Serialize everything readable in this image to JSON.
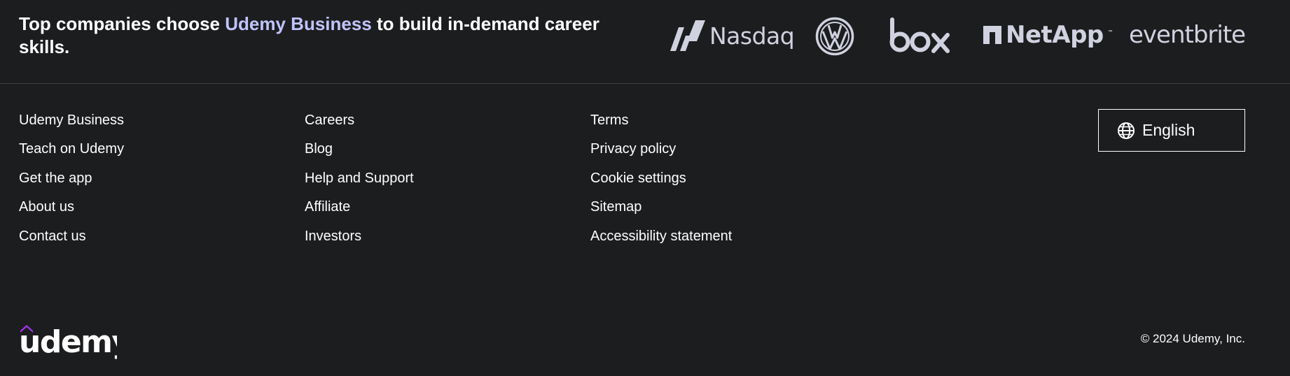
{
  "header": {
    "headline_before": "Top companies choose ",
    "headline_accent": "Udemy Business",
    "headline_after": " to build in-demand career skills.",
    "accent_color": "#c0c4fc"
  },
  "partner_logos": {
    "nasdaq": "Nasdaq",
    "vw": "vw-logo",
    "box": "box",
    "netapp": "NetApp",
    "netapp_tm": "™",
    "eventbrite": "eventbrite",
    "logo_color": "#d1d2e0"
  },
  "footer_links": {
    "col1": [
      "Udemy Business",
      "Teach on Udemy",
      "Get the app",
      "About us",
      "Contact us"
    ],
    "col2": [
      "Careers",
      "Blog",
      "Help and Support",
      "Affiliate",
      "Investors"
    ],
    "col3": [
      "Terms",
      "Privacy policy",
      "Cookie settings",
      "Sitemap",
      "Accessibility statement"
    ]
  },
  "language": {
    "label": "English",
    "icon": "globe-icon"
  },
  "brand": {
    "name": "udemy",
    "hat_color": "#a435f0"
  },
  "copyright": "© 2024 Udemy, Inc.",
  "colors": {
    "background": "#1c1d1f",
    "divider": "#3e4143",
    "text": "#ffffff"
  }
}
